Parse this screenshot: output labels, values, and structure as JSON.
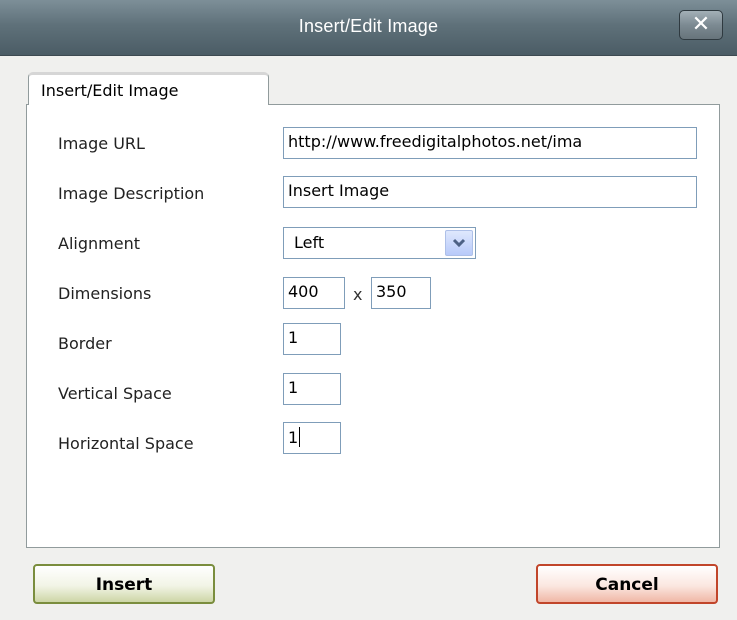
{
  "dialog": {
    "title": "Insert/Edit Image",
    "close_label": "✕"
  },
  "tabs": [
    {
      "label": "Insert/Edit Image"
    }
  ],
  "form": {
    "image_url": {
      "label": "Image URL",
      "value": "http://www.freedigitalphotos.net/ima"
    },
    "image_description": {
      "label": "Image Description",
      "value": "Insert Image"
    },
    "alignment": {
      "label": "Alignment",
      "value": "Left"
    },
    "dimensions": {
      "label": "Dimensions",
      "width": "400",
      "separator": "x",
      "height": "350"
    },
    "border": {
      "label": "Border",
      "value": "1"
    },
    "vertical_space": {
      "label": "Vertical Space",
      "value": "1"
    },
    "horizontal_space": {
      "label": "Horizontal Space",
      "value": "1"
    }
  },
  "buttons": {
    "insert": "Insert",
    "cancel": "Cancel"
  },
  "colors": {
    "titlebar": "#5f717a",
    "insert_border": "#7a8d3d",
    "cancel_border": "#c1452a"
  }
}
